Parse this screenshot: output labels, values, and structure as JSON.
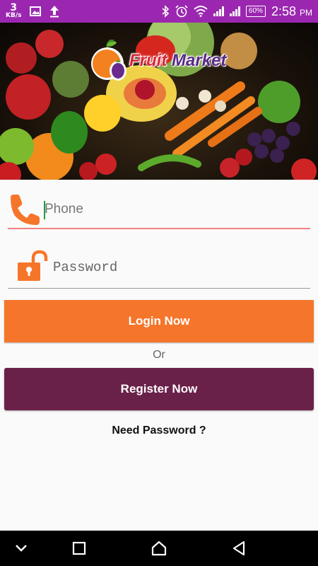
{
  "status_bar": {
    "net_speed_value": "3",
    "net_speed_unit": "KB/s",
    "battery": "60%",
    "time": "2:58",
    "ampm": "PM",
    "background": "#9b27b0"
  },
  "banner": {
    "logo_word1": "Fruit",
    "logo_word2": "Market"
  },
  "form": {
    "phone_placeholder": "Phone",
    "password_placeholder": "Password",
    "phone_underline_color": "#f38181",
    "icon_color": "#f5762b"
  },
  "buttons": {
    "login_label": "Login Now",
    "login_color": "#f5762b",
    "or_text": "Or",
    "register_label": "Register Now",
    "register_color": "#6a2149",
    "need_password_label": "Need Password ?"
  },
  "nav": {
    "items": [
      "chevron-down-icon",
      "recents-icon",
      "home-icon",
      "back-icon"
    ]
  }
}
